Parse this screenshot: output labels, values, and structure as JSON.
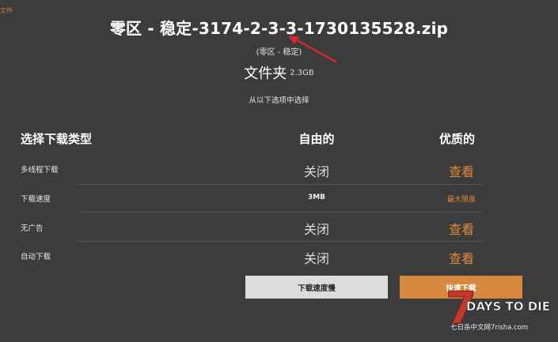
{
  "top_left_link": "文件",
  "file": {
    "name": "零区 - 稳定-3174-2-3-3-1730135528.zip",
    "subtitle": "(零区 - 稳定)",
    "folder_label": "文件夹",
    "size": "2.3GB",
    "hint": "从以下选项中选择"
  },
  "table": {
    "headers": {
      "type": "选择下载类型",
      "free": "自由的",
      "premium": "优质的"
    },
    "rows": [
      {
        "label": "多线程下载",
        "free": "关闭",
        "premium": "查看"
      },
      {
        "label": "下载速度",
        "free": "3MB",
        "premium": "最大限度"
      },
      {
        "label": "无广告",
        "free": "关闭",
        "premium": "查看"
      },
      {
        "label": "自动下载",
        "free": "关闭",
        "premium": "查看"
      }
    ]
  },
  "buttons": {
    "slow": "下载速度慢",
    "fast": "快速下载"
  },
  "watermark": {
    "number": "7",
    "title": "DAYS TO DIE",
    "caption": "七日杀中文网7risha.com"
  },
  "colors": {
    "background": "#3c3c3c",
    "accent": "#d6883e",
    "annotation_arrow": "#e0262b"
  }
}
